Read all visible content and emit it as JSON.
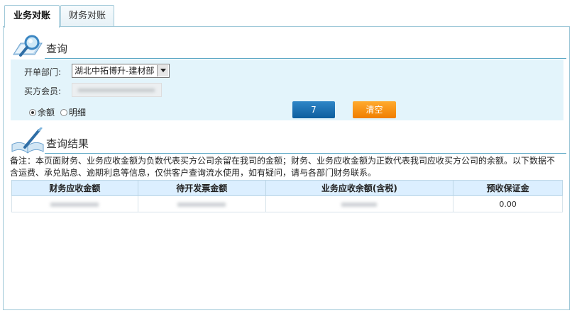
{
  "tabs": [
    {
      "label": "业务对账",
      "active": true
    },
    {
      "label": "财务对账",
      "active": false
    }
  ],
  "query": {
    "title": "查询",
    "dept_label": "开单部门:",
    "dept_value": "湖北中拓博升-建材部",
    "member_label": "买方会员:",
    "member_value": "",
    "radio_balance": "余额",
    "radio_detail": "明细",
    "radio_selected": "余额",
    "button_query": "7",
    "button_clear": "清空"
  },
  "results": {
    "title": "查询结果",
    "note": "备注：本页面财务、业务应收金额为负数代表买方公司余留在我司的金额；财务、业务应收金额为正数代表我司应收买方公司的余额。以下数据不含运费、承兑贴息、逾期利息等信息，仅供客户查询流水使用，如有疑问，请与各部门财务联系。",
    "columns": [
      "财务应收金额",
      "待开发票金额",
      "业务应收余额(含税)",
      "预收保证金"
    ],
    "rows": [
      [
        "",
        "",
        "",
        "0.00"
      ]
    ]
  },
  "colors": {
    "accent_blue": "#0d5e9e",
    "accent_orange": "#f07d00",
    "panel_bg": "#e3f4fb",
    "header_bg": "#dcefff"
  },
  "icons": [
    "magnifier-icon",
    "book-pen-icon"
  ]
}
